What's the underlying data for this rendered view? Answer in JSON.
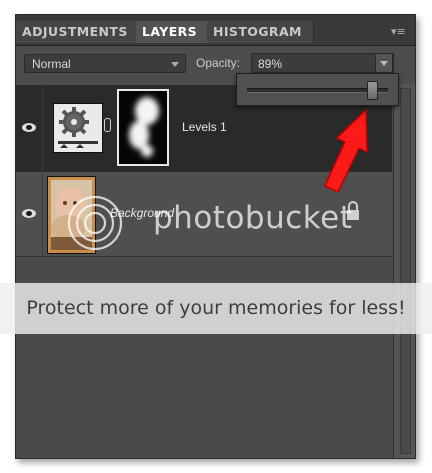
{
  "tabs": [
    {
      "label": "ADJUSTMENTS",
      "active": false
    },
    {
      "label": "LAYERS",
      "active": true
    },
    {
      "label": "HISTOGRAM",
      "active": false
    }
  ],
  "panel_menu_icon": "panel-menu-icon",
  "blend_mode": {
    "value": "Normal"
  },
  "opacity": {
    "label": "Opacity:",
    "value": "89%",
    "level": 0.89
  },
  "layers": [
    {
      "name": "Levels 1",
      "type": "adjustment",
      "visible": true,
      "selected": true
    },
    {
      "name": "Background",
      "type": "image",
      "visible": true,
      "selected": false,
      "locked": true
    }
  ],
  "watermark": {
    "text": "photobucket"
  },
  "banner": {
    "text": "Protect more of your memories for less!"
  },
  "colors": {
    "panel": "#4a4a4a",
    "selected_row": "#2a2a2a",
    "annotation_arrow": "#ff1a1a"
  }
}
